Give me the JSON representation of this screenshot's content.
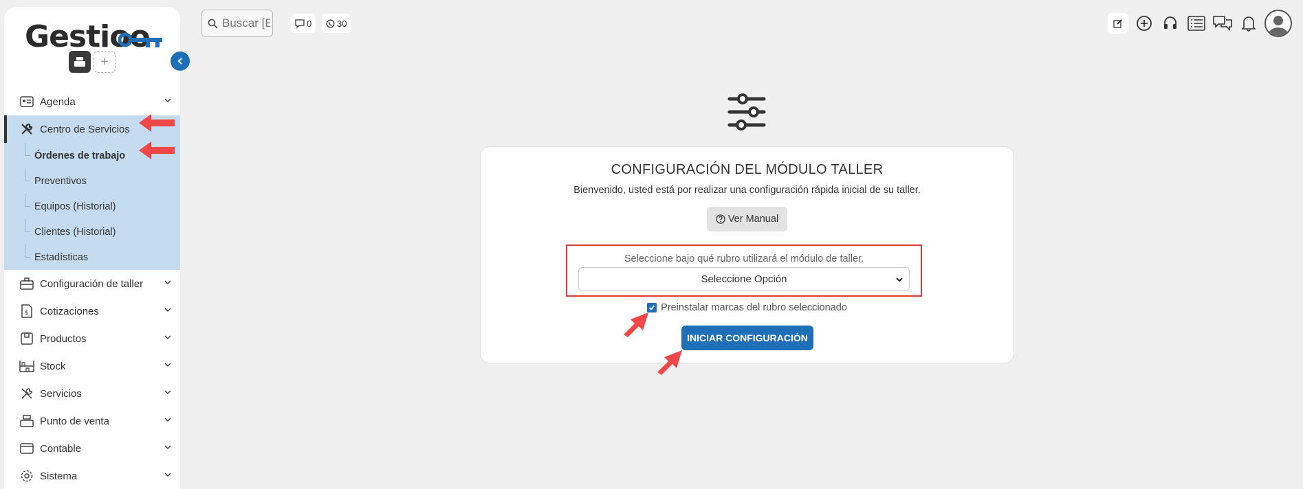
{
  "brand": {
    "logo_text": "Gestioo",
    "accent": "#1f6fb8"
  },
  "sidebar": {
    "items": [
      {
        "label": "Agenda",
        "icon": "address-card-icon"
      },
      {
        "label": "Centro de Servicios",
        "icon": "tools-icon"
      },
      {
        "label": "Configuración de taller",
        "icon": "toolbox-icon"
      },
      {
        "label": "Cotizaciones",
        "icon": "quote-file-icon"
      },
      {
        "label": "Productos",
        "icon": "box-icon"
      },
      {
        "label": "Stock",
        "icon": "shelves-icon"
      },
      {
        "label": "Servicios",
        "icon": "tools-icon"
      },
      {
        "label": "Punto de venta",
        "icon": "cash-register-icon"
      },
      {
        "label": "Contable",
        "icon": "wallet-icon"
      },
      {
        "label": "Sistema",
        "icon": "gear-icon"
      }
    ],
    "subitems": [
      {
        "label": "Órdenes de trabajo",
        "active": true
      },
      {
        "label": "Preventivos"
      },
      {
        "label": "Equipos (Historial)"
      },
      {
        "label": "Clientes (Historial)"
      },
      {
        "label": "Estadísticas"
      }
    ]
  },
  "topbar": {
    "search_placeholder": "Buscar [E",
    "comments_count": "0",
    "whatsapp_count": "30"
  },
  "card": {
    "title": "CONFIGURACIÓN DEL MÓDULO TALLER",
    "subtitle": "Bienvenido, usted está por realizar una configuración rápida inicial de su taller.",
    "manual_button": "Ver Manual",
    "select_label": "Seleccione bajo qué rubro utilizará el módulo de taller.",
    "select_value": "Seleccione Opción",
    "checkbox_label": "Preinstalar marcas del rubro seleccionado",
    "checkbox_checked": true,
    "start_button": "INICIAR CONFIGURACIÓN"
  }
}
